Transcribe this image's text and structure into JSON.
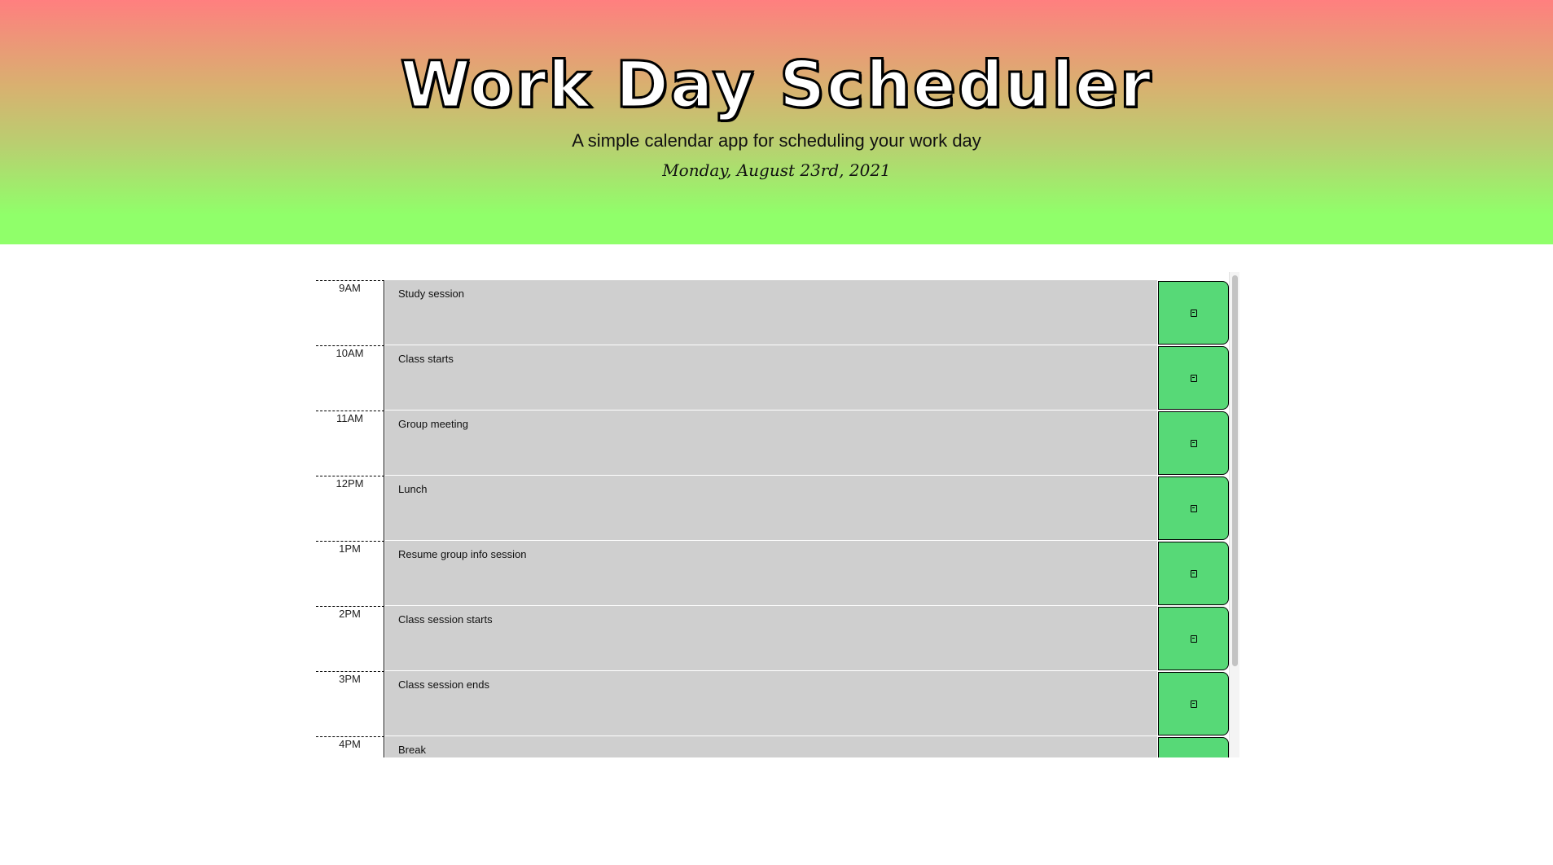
{
  "header": {
    "title": "Work Day Scheduler",
    "lead": "A simple calendar app for scheduling your work day",
    "current_day": "Monday, August 23rd, 2021"
  },
  "colors": {
    "header_gradient_top": "#ff7f7f",
    "header_gradient_bottom": "#90ff6a",
    "row_past": "#cfcfcf",
    "save_button": "#57d977"
  },
  "save_icon": "save-icon",
  "timeblocks": [
    {
      "hour": "9AM",
      "text": "Study session"
    },
    {
      "hour": "10AM",
      "text": "Class starts"
    },
    {
      "hour": "11AM",
      "text": "Group meeting"
    },
    {
      "hour": "12PM",
      "text": "Lunch"
    },
    {
      "hour": "1PM",
      "text": "Resume group info session"
    },
    {
      "hour": "2PM",
      "text": "Class session starts"
    },
    {
      "hour": "3PM",
      "text": "Class session  ends"
    },
    {
      "hour": "4PM",
      "text": "Break"
    }
  ]
}
